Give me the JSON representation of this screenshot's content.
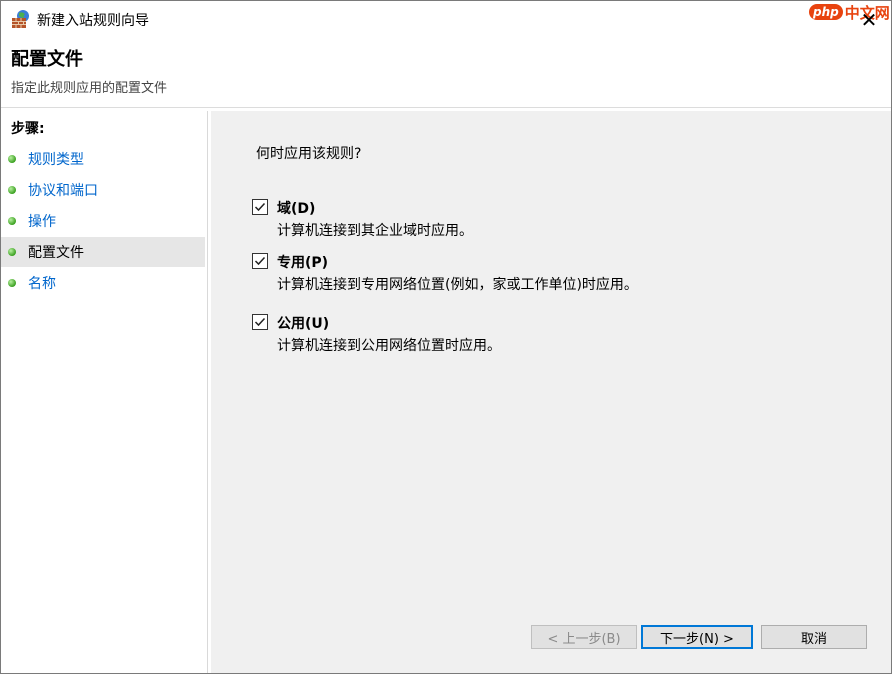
{
  "window": {
    "title": "新建入站规则向导",
    "close_glyph": "✕"
  },
  "watermark": {
    "logo": "php",
    "text": "中文网"
  },
  "header": {
    "title": "配置文件",
    "subtitle": "指定此规则应用的配置文件"
  },
  "sidebar": {
    "title": "步骤:",
    "items": [
      {
        "label": "规则类型",
        "active": false
      },
      {
        "label": "协议和端口",
        "active": false
      },
      {
        "label": "操作",
        "active": false
      },
      {
        "label": "配置文件",
        "active": true
      },
      {
        "label": "名称",
        "active": false
      }
    ]
  },
  "main": {
    "question": "何时应用该规则?",
    "options": [
      {
        "title": "域(D)",
        "desc": "计算机连接到其企业域时应用。",
        "checked": true
      },
      {
        "title": "专用(P)",
        "desc": "计算机连接到专用网络位置(例如，家或工作单位)时应用。",
        "checked": true
      },
      {
        "title": "公用(U)",
        "desc": "计算机连接到公用网络位置时应用。",
        "checked": true
      }
    ]
  },
  "buttons": {
    "back": "< 上一步(B)",
    "next": "下一步(N) >",
    "cancel": "取消"
  },
  "colors": {
    "link": "#0066cc",
    "content_bg": "#f0f0f0",
    "primary_border": "#0078d7"
  }
}
